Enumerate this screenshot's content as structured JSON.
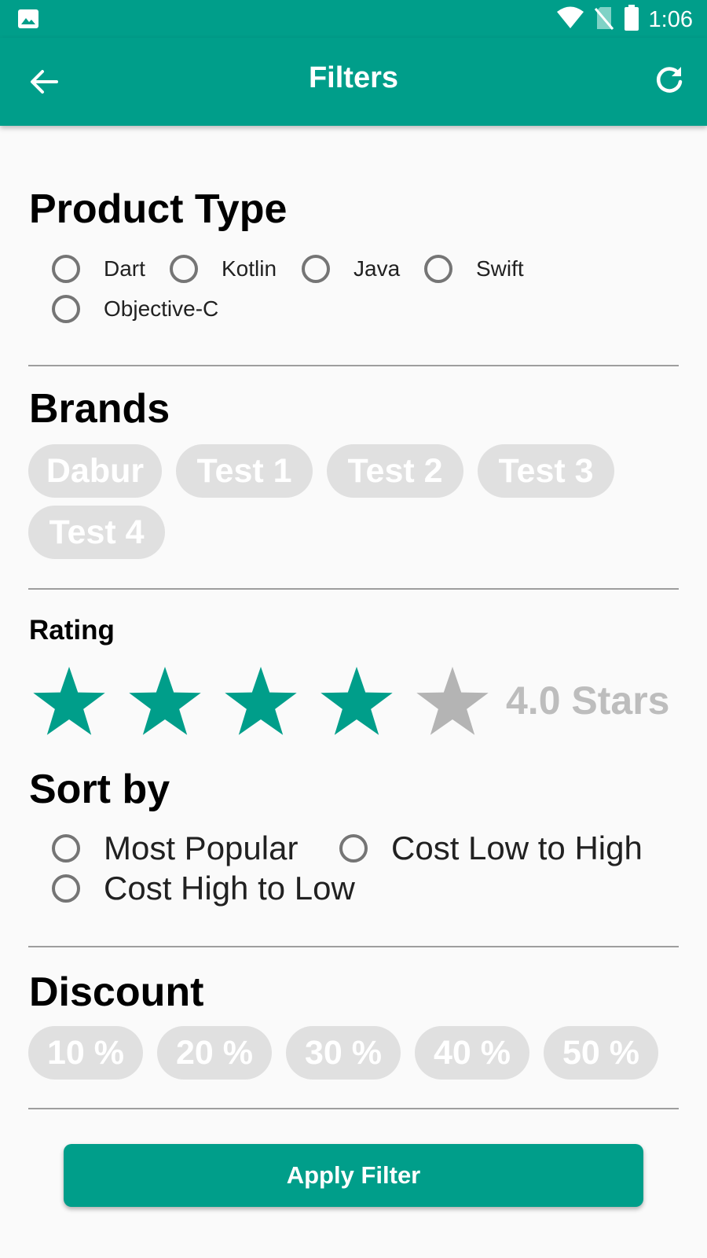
{
  "status_bar": {
    "time": "1:06"
  },
  "app_bar": {
    "title": "Filters"
  },
  "product_type": {
    "title": "Product Type",
    "options": [
      "Dart",
      "Kotlin",
      "Java",
      "Swift",
      "Objective-C"
    ]
  },
  "brands": {
    "title": "Brands",
    "chips": [
      "Dabur",
      "Test 1",
      "Test 2",
      "Test 3",
      "Test 4"
    ]
  },
  "rating": {
    "title": "Rating",
    "value": 4,
    "max": 5,
    "text": "4.0 Stars",
    "filled_color": "#009e8a",
    "empty_color": "#b4b4b4"
  },
  "sort_by": {
    "title": "Sort by",
    "options": [
      "Most Popular",
      "Cost Low to High",
      "Cost High to Low"
    ]
  },
  "discount": {
    "title": "Discount",
    "chips": [
      "10 %",
      "20 %",
      "30 %",
      "40 %",
      "50 %"
    ]
  },
  "apply_button": {
    "label": "Apply Filter"
  },
  "colors": {
    "accent": "#009e8a",
    "chip_bg": "#e0e0e0"
  }
}
